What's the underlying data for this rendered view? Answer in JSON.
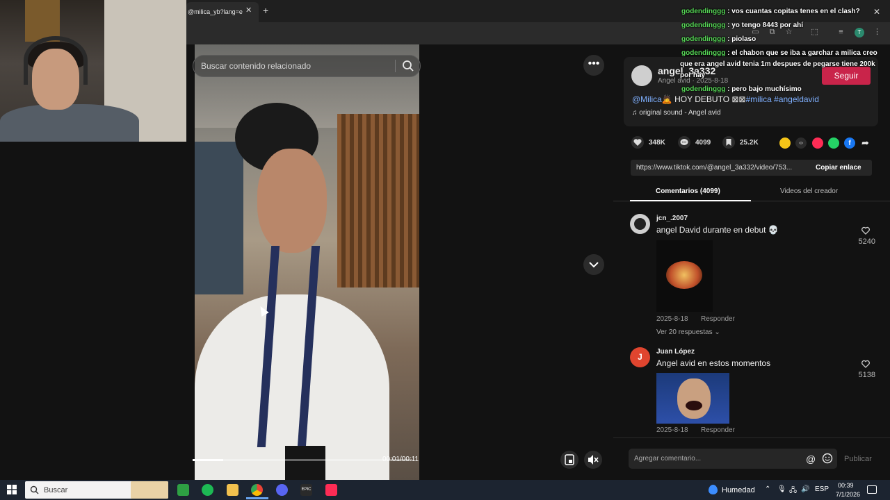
{
  "browser": {
    "tab_title": "@milica_yb?lang=e",
    "tab_close": "✕",
    "new_tab": "+"
  },
  "video": {
    "search_placeholder": "Buscar contenido relacionado",
    "time": "00:01/00:11",
    "progress": 0.14,
    "more": "•••"
  },
  "author": {
    "username": "angel_3a332",
    "subline": "Angel avid · 2025-8-18",
    "follow": "Seguir"
  },
  "caption": {
    "mention": "@Milica🙇",
    "text": " HOY DEBUTO ",
    "box": "⊠⊠",
    "hashtags": "#milica #angeldavid",
    "sound": "♫  original sound - Angel avid"
  },
  "stats": {
    "likes": "348K",
    "comments": "4099",
    "saves": "25.2K"
  },
  "share_colors": [
    "#f5c518",
    "#2b2b2b",
    "#fe2c55",
    "#25d366",
    "#1877f2"
  ],
  "link": {
    "url": "https://www.tiktok.com/@angel_3a332/video/753...",
    "copy": "Copiar enlace"
  },
  "tabs": {
    "comments": "Comentarios (4099)",
    "creator": "Videos del creador"
  },
  "comments": [
    {
      "user": "jcn_.2007",
      "text": "angel David durante en debut 💀",
      "date": "2025-8-18",
      "reply": "Responder",
      "likes": "5240",
      "see_replies": "Ver 20 respuestas ⌄"
    },
    {
      "user": "Juan López",
      "initial": "J",
      "text": "Angel avid en estos momentos",
      "date": "2025-8-18",
      "reply": "Responder",
      "likes": "5138"
    }
  ],
  "composer": {
    "placeholder": "Agregar comentario...",
    "at": "@",
    "publish": "Publicar"
  },
  "chat": [
    {
      "user": "godendinggg",
      "msg": ": vos cuantas copitas tenes en el clash?"
    },
    {
      "user": "godendinggg",
      "msg": ": yo tengo 8443 por ahí"
    },
    {
      "user": "godendinggg",
      "msg": ": piolaso"
    },
    {
      "user": "godendinggg",
      "msg": ": el chabon que se iba a garchar a milica creo"
    },
    {
      "user": "",
      "msg": "que era angel avid tenia 1m despues de pegarse tiene 200k"
    },
    {
      "user": "",
      "msg": "por hay"
    },
    {
      "user": "godendinggg",
      "msg": ": pero bajo muchísimo"
    }
  ],
  "chat_close": "✕",
  "taskbar": {
    "search": "Buscar",
    "weather": "Humedad",
    "lang": "ESP",
    "time": "00:39",
    "date": "7/1/2026",
    "apps": [
      "#2ea043",
      "#1db954",
      "#f2c14e",
      "#e0e0e0",
      "#5865f2",
      "#2a2a2a",
      "#fe2c55"
    ]
  }
}
